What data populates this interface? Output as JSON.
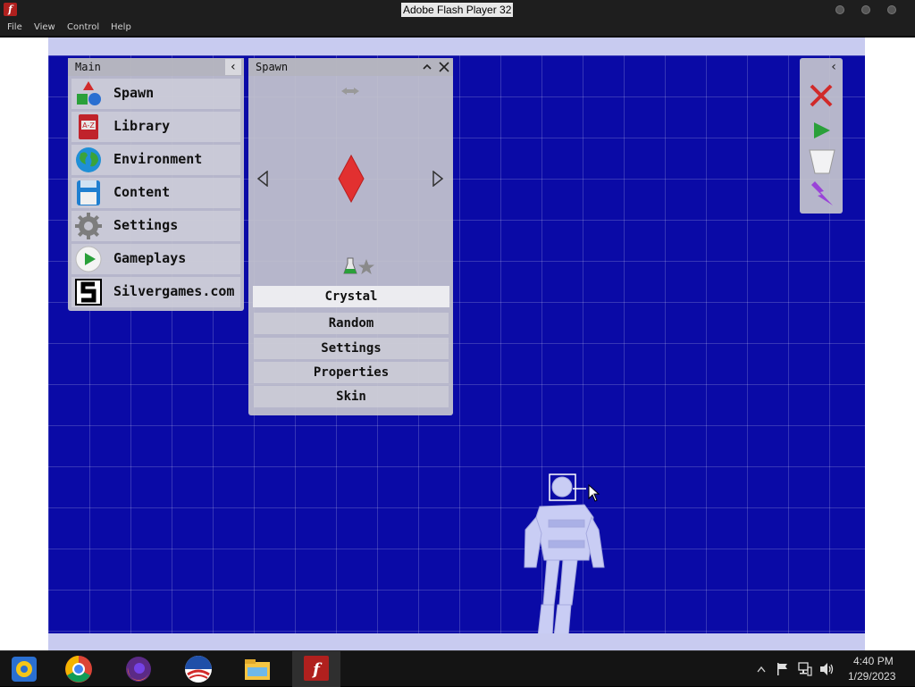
{
  "window": {
    "title": "Adobe Flash Player 32"
  },
  "menu": [
    "File",
    "View",
    "Control",
    "Help"
  ],
  "main_panel": {
    "title": "Main",
    "collapse_glyph": "‹",
    "items": [
      {
        "label": "Spawn",
        "icon": "spawn-shapes-icon"
      },
      {
        "label": "Library",
        "icon": "library-book-icon"
      },
      {
        "label": "Environment",
        "icon": "globe-icon"
      },
      {
        "label": "Content",
        "icon": "floppy-disk-icon"
      },
      {
        "label": "Settings",
        "icon": "gear-icon"
      },
      {
        "label": "Gameplays",
        "icon": "play-icon"
      },
      {
        "label": "Silvergames.com",
        "icon": "silvergames-logo-icon"
      }
    ]
  },
  "spawn_panel": {
    "title": "Spawn",
    "selected": "Crystal",
    "options": [
      "Random",
      "Settings",
      "Properties",
      "Skin"
    ]
  },
  "toolbar": {
    "collapse_glyph": "‹",
    "tools": [
      "close-x-icon",
      "play-icon",
      "bucket-icon",
      "lightning-icon"
    ]
  },
  "taskbar": {
    "apps": [
      "ie-icon",
      "chrome-icon",
      "firefox-icon",
      "obama-logo-icon",
      "file-explorer-icon",
      "flash-player-icon"
    ],
    "time": "4:40 PM",
    "date": "1/29/2023"
  },
  "colors": {
    "playfield": "#0a0aa6",
    "panel": "#c4c4ce",
    "crystal": "#e23030"
  }
}
